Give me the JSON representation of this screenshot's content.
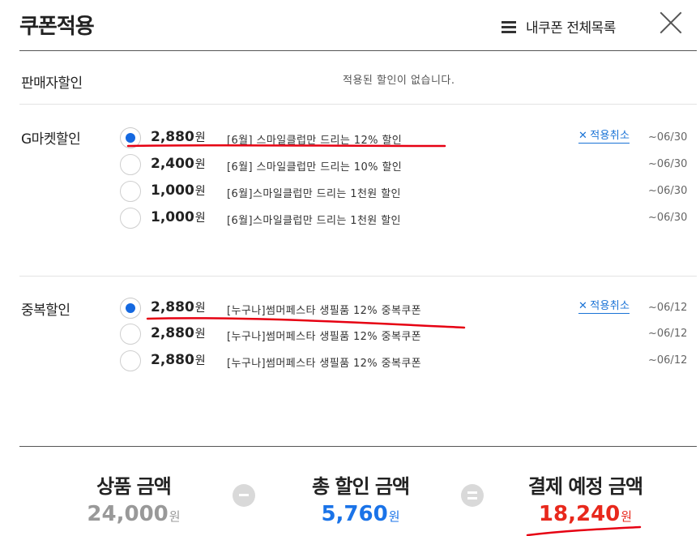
{
  "header": {
    "title": "쿠폰적용",
    "my_coupons_label": "내쿠폰 전체목록"
  },
  "seller": {
    "label": "판매자할인",
    "message": "적용된 할인이 없습니다."
  },
  "gmarket": {
    "label": "G마켓할인",
    "cancel_label": "적용취소",
    "cancel_x": "✕",
    "items": [
      {
        "amount": "2,880",
        "unit": "원",
        "desc": "[6월] 스마일클럽만 드리는 12% 할인",
        "date": "~06/30",
        "selected": true
      },
      {
        "amount": "2,400",
        "unit": "원",
        "desc": "[6월] 스마일클럽만 드리는 10% 할인",
        "date": "~06/30",
        "selected": false
      },
      {
        "amount": "1,000",
        "unit": "원",
        "desc": "[6월]스마일클럽만 드리는 1천원 할인",
        "date": "~06/30",
        "selected": false
      },
      {
        "amount": "1,000",
        "unit": "원",
        "desc": "[6월]스마일클럽만 드리는 1천원 할인",
        "date": "~06/30",
        "selected": false
      }
    ]
  },
  "duplicate": {
    "label": "중복할인",
    "cancel_label": "적용취소",
    "cancel_x": "✕",
    "items": [
      {
        "amount": "2,880",
        "unit": "원",
        "desc": "[누구나]썸머페스타 생필품 12% 중복쿠폰",
        "date": "~06/12",
        "selected": true
      },
      {
        "amount": "2,880",
        "unit": "원",
        "desc": "[누구나]썸머페스타 생필품 12% 중복쿠폰",
        "date": "~06/12",
        "selected": false
      },
      {
        "amount": "2,880",
        "unit": "원",
        "desc": "[누구나]썸머페스타 생필품 12% 중복쿠폰",
        "date": "~06/12",
        "selected": false
      }
    ]
  },
  "totals": {
    "product": {
      "label": "상품 금액",
      "value": "24,000",
      "unit": "원"
    },
    "discount": {
      "label": "총 할인 금액",
      "value": "5,760",
      "unit": "원"
    },
    "payment": {
      "label": "결제 예정 금액",
      "value": "18,240",
      "unit": "원"
    }
  },
  "colors": {
    "accent_blue": "#1468e0",
    "discount_blue": "#1a73e8",
    "payment_red": "#e8281c",
    "product_gray": "#999999",
    "annotation_red": "#e60012"
  }
}
